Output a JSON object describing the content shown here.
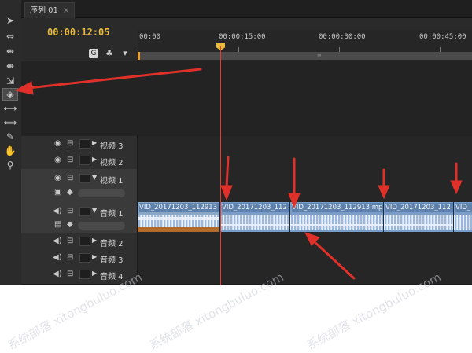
{
  "sequence_tab": {
    "label": "序列 01",
    "close": "×"
  },
  "timecode": "00:00:12:05",
  "ruler": {
    "labels": [
      "00:00",
      "00:00:15:00",
      "00:00:30:00",
      "00:00:45:00"
    ],
    "work_area_mark": "≡"
  },
  "controls": {
    "snap": "G",
    "marker": "♣",
    "add_marker": "▾"
  },
  "tools": [
    "selection-tool",
    "track-select-tool",
    "ripple-edit-tool",
    "rolling-edit-tool",
    "rate-stretch-tool",
    "razor-tool",
    "slip-tool",
    "slide-tool",
    "pen-tool",
    "hand-tool",
    "zoom-tool"
  ],
  "tracks": {
    "v3": "视频 3",
    "v2": "视频 2",
    "v1": "视频 1",
    "a1": "音频 1",
    "a2": "音频 2",
    "a3": "音频 3",
    "a4": "音频 4"
  },
  "clips": [
    {
      "label": "VID_20171203_112913"
    },
    {
      "label": "VID_20171203_112"
    },
    {
      "label": "VID_20171203_112913.mp"
    },
    {
      "label": "VID_20171203_112"
    },
    {
      "label": "VID_"
    }
  ],
  "colors": {
    "playhead": "#e0402a",
    "timecode": "#e8b93a",
    "clip": "#7a9cc8",
    "annotation_arrow": "#e0302a"
  },
  "watermark": "系统部落 xitongbuluo.com"
}
